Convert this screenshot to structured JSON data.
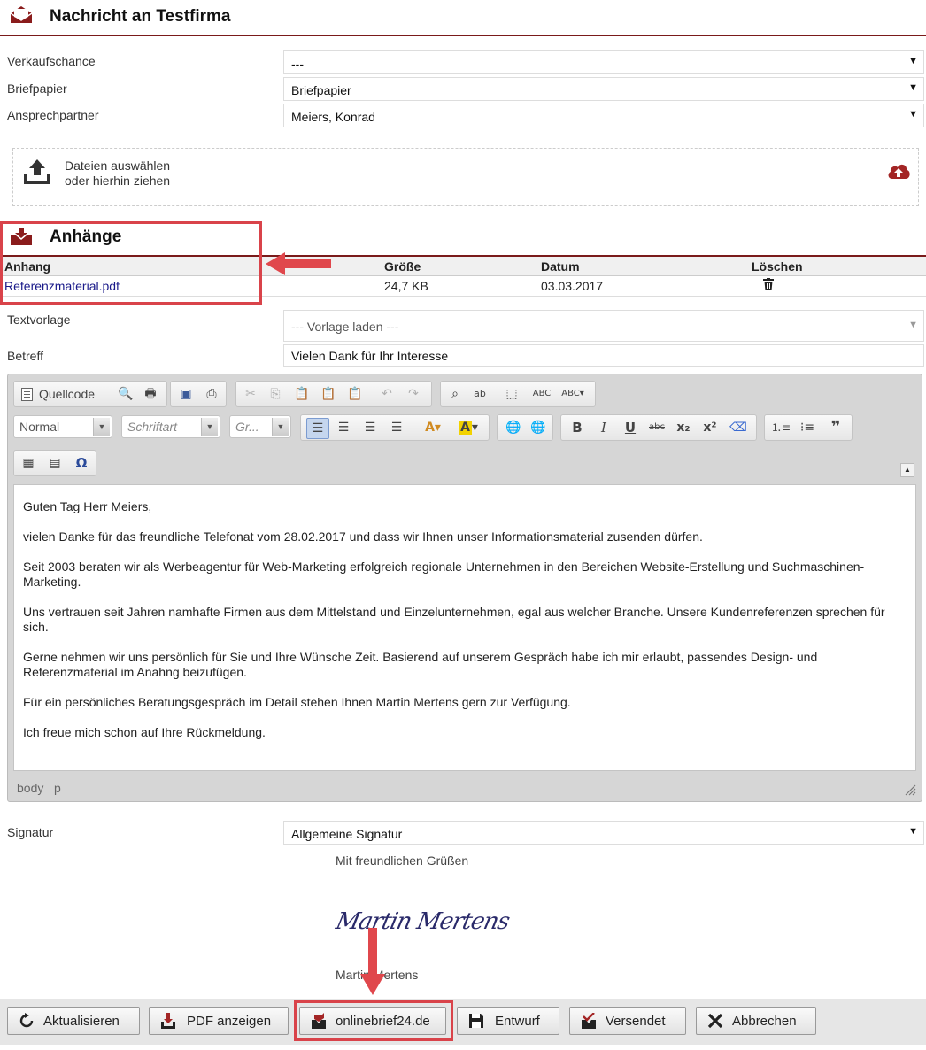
{
  "header": {
    "title": "Nachricht an Testfirma"
  },
  "form": {
    "verkaufschance": {
      "label": "Verkaufschance",
      "value": "---"
    },
    "briefpapier": {
      "label": "Briefpapier",
      "value": "Briefpapier"
    },
    "ansprechpartner": {
      "label": "Ansprechpartner",
      "value": "Meiers, Konrad"
    }
  },
  "upload": {
    "line1": "Dateien auswählen",
    "line2": "oder hierhin ziehen"
  },
  "attachments": {
    "title": "Anhänge",
    "columns": [
      "Anhang",
      "Größe",
      "Datum",
      "Löschen"
    ],
    "rows": [
      {
        "name": "Referenzmaterial.pdf",
        "size": "24,7 KB",
        "date": "03.03.2017"
      }
    ]
  },
  "textvorlage": {
    "label": "Textvorlage",
    "value": "--- Vorlage laden ---"
  },
  "betreff": {
    "label": "Betreff",
    "value": "Vielen Dank für Ihr Interesse"
  },
  "editor": {
    "source_label": "Quellcode",
    "format_combo": "Normal",
    "font_combo": "Schriftart",
    "size_combo": "Gr...",
    "path": "body   p",
    "paragraphs": [
      "Guten Tag Herr Meiers,",
      "vielen Danke für das freundliche Telefonat vom 28.02.2017 und dass wir Ihnen unser Informationsmaterial zusenden dürfen.",
      "Seit 2003 beraten wir als Werbeagentur für Web-Marketing erfolgreich regionale Unternehmen in den Bereichen Website-Erstellung und Suchmaschinen-Marketing.",
      "Uns vertrauen seit Jahren namhafte Firmen aus dem Mittelstand und Einzelunternehmen, egal aus welcher Branche. Unsere Kundenreferenzen sprechen für sich.",
      "Gerne nehmen wir uns persönlich für Sie und Ihre Wünsche Zeit. Basierend auf unserem Gespräch habe ich mir erlaubt, passendes Design- und Referenzmaterial im Anahng beizufügen.",
      "Für ein persönliches Beratungsgespräch im Detail stehen Ihnen Martin Mertens gern zur Verfügung.",
      "Ich freue mich schon auf Ihre Rückmeldung."
    ]
  },
  "signatur": {
    "label": "Signatur",
    "value": "Allgemeine Signatur",
    "greeting": "Mit freundlichen Grüßen",
    "signature_script": "Martin Mertens",
    "name": "Martin Mertens"
  },
  "buttons": {
    "refresh": "Aktualisieren",
    "pdf": "PDF anzeigen",
    "onlinebrief": "onlinebrief24.de",
    "draft": "Entwurf",
    "sent": "Versendet",
    "cancel": "Abbrechen"
  },
  "colors": {
    "accent": "#7a1a1a",
    "highlight": "#d9434a",
    "link": "#1a1a8a"
  }
}
